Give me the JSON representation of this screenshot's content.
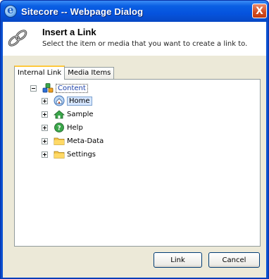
{
  "window": {
    "title": "Sitecore -- Webpage Dialog",
    "close_label": "X"
  },
  "header": {
    "title": "Insert a Link",
    "subtitle": "Select the item or media that you want to create a link to."
  },
  "tabs": [
    {
      "label": "Internal Link",
      "active": true
    },
    {
      "label": "Media Items",
      "active": false
    }
  ],
  "tree": {
    "root": {
      "label": "Content",
      "icon": "content-icon"
    },
    "children": [
      {
        "label": "Home",
        "icon": "home-icon",
        "selected": true
      },
      {
        "label": "Sample",
        "icon": "sample-icon"
      },
      {
        "label": "Help",
        "icon": "help-icon"
      },
      {
        "label": "Meta-Data",
        "icon": "folder-icon"
      },
      {
        "label": "Settings",
        "icon": "folder-icon"
      }
    ]
  },
  "buttons": {
    "link": "Link",
    "cancel": "Cancel"
  },
  "colors": {
    "titlebar": "#0553de",
    "close": "#d24a1e",
    "body": "#ece9d8",
    "content_label": "#1a3ea8"
  }
}
